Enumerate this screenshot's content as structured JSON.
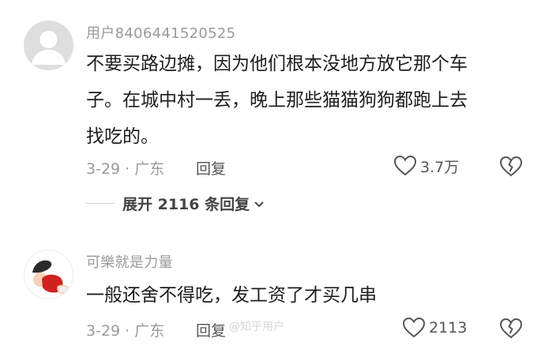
{
  "colors": {
    "meta": "#9a9a9a",
    "text": "#1e1e1e",
    "icon": "#555555",
    "avatar_default": "#dedede"
  },
  "comments": [
    {
      "username": "用户8406441520525",
      "text_lines": [
        "不要买路边摊，因为他们根本没地方放它那个车",
        "子。在城中村一丢，晚上那些猫猫狗狗都跑上去",
        "找吃的。"
      ],
      "date_location": "3-29 · 广东",
      "reply_label": "回复",
      "likes": "3.7万",
      "like_icon": "heart-outline-icon",
      "dislike_icon": "broken-heart-icon",
      "avatar_icon": "default-user-avatar-icon"
    },
    {
      "username": "可樂就是力量",
      "text_lines": [
        "一般还舍不得吃，发工资了才买几串"
      ],
      "date_location": "3-29 · 广东",
      "reply_label": "回复",
      "likes": "2113",
      "like_icon": "heart-outline-icon",
      "dislike_icon": "broken-heart-icon",
      "avatar_icon": "cartoon-avatar-icon"
    }
  ],
  "expand_replies": {
    "label": "展开 2116 条回复",
    "icon": "chevron-down-icon"
  },
  "watermark": "@知乎用户"
}
